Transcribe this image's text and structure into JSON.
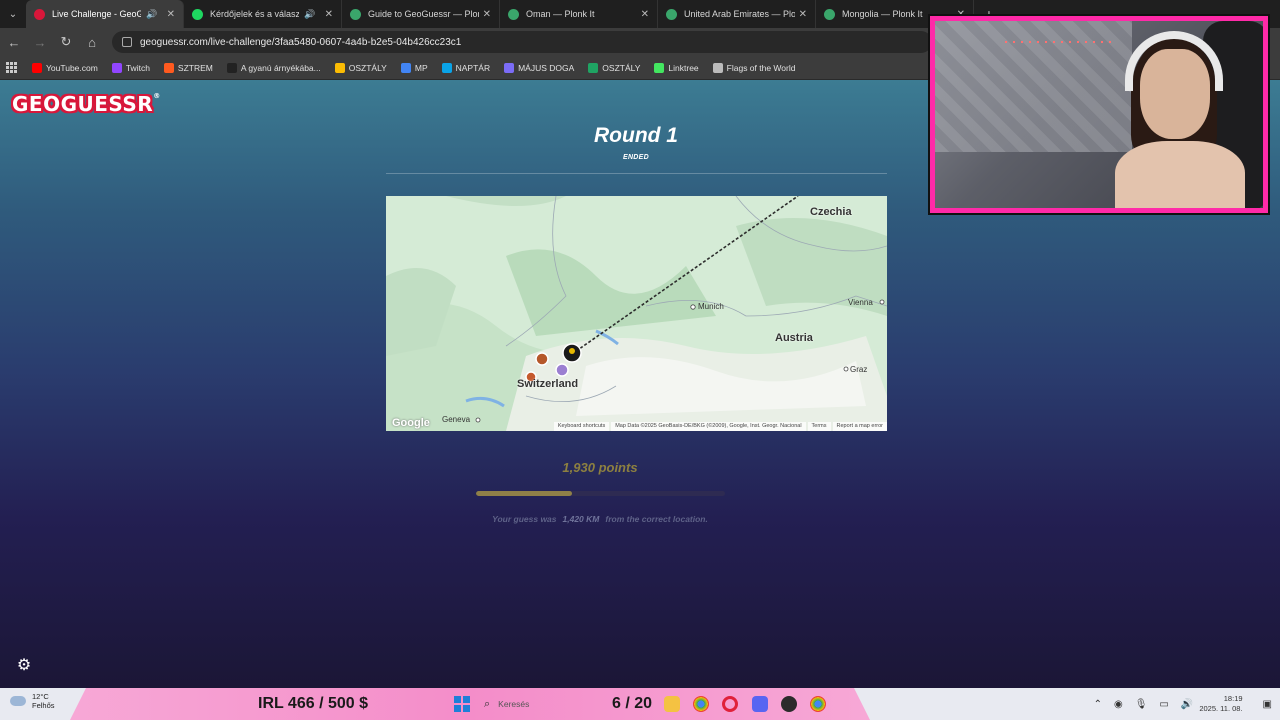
{
  "browser": {
    "tabs": [
      {
        "title": "Live Challenge - GeoGuessr",
        "active": true,
        "audio": true,
        "favicon_color": "#d8173a"
      },
      {
        "title": "Kérdőjelek és a válaszok • ħ",
        "active": false,
        "audio": true,
        "favicon_color": "#1ed760"
      },
      {
        "title": "Guide to GeoGuessr — Plonk It",
        "active": false,
        "audio": false,
        "favicon_color": "#3aa66b"
      },
      {
        "title": "Oman — Plonk It",
        "active": false,
        "audio": false,
        "favicon_color": "#3aa66b"
      },
      {
        "title": "United Arab Emirates — Plonk",
        "active": false,
        "audio": false,
        "favicon_color": "#3aa66b"
      },
      {
        "title": "Mongolia — Plonk It",
        "active": false,
        "audio": false,
        "favicon_color": "#3aa66b"
      }
    ],
    "url": "geoguessr.com/live-challenge/3faa5480-0607-4a4b-b2e5-04b426cc23c1",
    "bookmarks": [
      {
        "label": "YouTube.com",
        "color": "#ff0000"
      },
      {
        "label": "Twitch",
        "color": "#9146ff"
      },
      {
        "label": "SZTREM",
        "color": "#ff5a1f"
      },
      {
        "label": "A gyanú árnyékába...",
        "color": "#222222"
      },
      {
        "label": "OSZTÁLY",
        "color": "#fbbc04"
      },
      {
        "label": "MP",
        "color": "#4285f4"
      },
      {
        "label": "NAPTÁR",
        "color": "#0aa4e8"
      },
      {
        "label": "MÁJUS DOGA",
        "color": "#7b6cf6"
      },
      {
        "label": "OSZTÁLY",
        "color": "#1fa463"
      },
      {
        "label": "Linktree",
        "color": "#43e660"
      },
      {
        "label": "Flags of the World",
        "color": "#bbbbbb"
      }
    ]
  },
  "game": {
    "logo": "GEOGUESSR",
    "round_title": "Round 1",
    "round_status": "ENDED",
    "points_text": "1,930 points",
    "points_fraction": 0.386,
    "result_prefix": "Your guess was",
    "result_distance": "1,420 KM",
    "result_suffix": "from the correct location."
  },
  "map": {
    "labels": {
      "czechia": "Czechia",
      "austria": "Austria",
      "switzerland": "Switzerland",
      "munich": "Munich",
      "vienna": "Vienna",
      "graz": "Graz",
      "geneva": "Geneva"
    },
    "footer": {
      "shortcuts": "Keyboard shortcuts",
      "data": "Map Data ©2025 GeoBasis-DE/BKG (©2009), Google, Inst. Geogr. Nacional",
      "terms": "Terms",
      "report": "Report a map error"
    },
    "google": "Google"
  },
  "stream": {
    "irl": "IRL  466 / 500 $",
    "counter": "6 / 20"
  },
  "taskbar": {
    "temp": "12°C",
    "weather": "Felhős",
    "search": "Keresés",
    "time": "18:19",
    "date": "2025. 11. 08."
  }
}
